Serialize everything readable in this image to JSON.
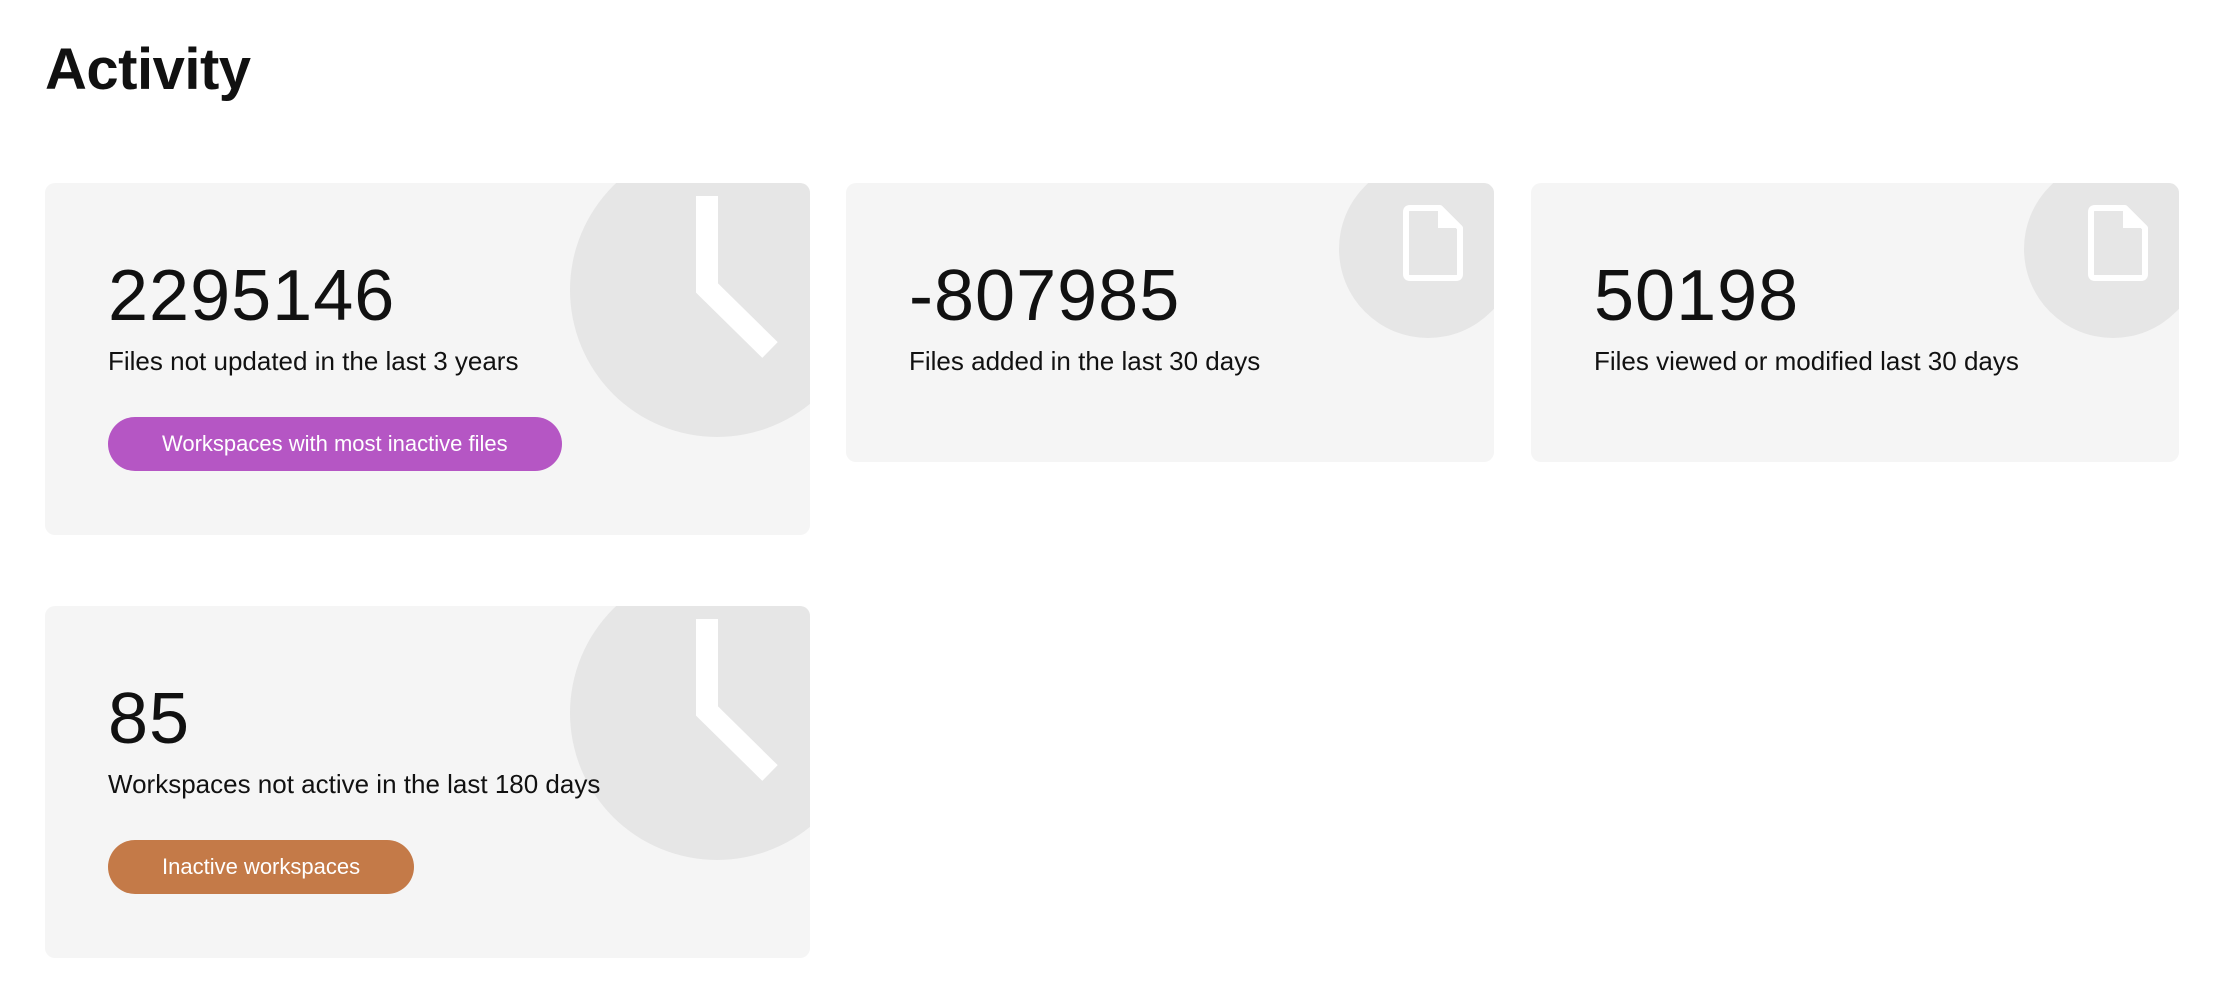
{
  "page": {
    "title": "Activity"
  },
  "colors": {
    "card_background": "#f5f5f5",
    "icon_circle": "#e6e6e6",
    "button_purple": "#b556c4",
    "button_orange": "#c47a48"
  },
  "cards": [
    {
      "value": "2295146",
      "label": "Files not updated in the last 3 years",
      "icon": "clock-icon",
      "button_label": "Workspaces with most inactive files"
    },
    {
      "value": "-807985",
      "label": "Files added in the last 30 days",
      "icon": "document-icon"
    },
    {
      "value": "50198",
      "label": "Files viewed or modified last 30 days",
      "icon": "document-icon"
    },
    {
      "value": "85",
      "label": "Workspaces not active in the last 180 days",
      "icon": "clock-icon",
      "button_label": "Inactive workspaces"
    }
  ]
}
